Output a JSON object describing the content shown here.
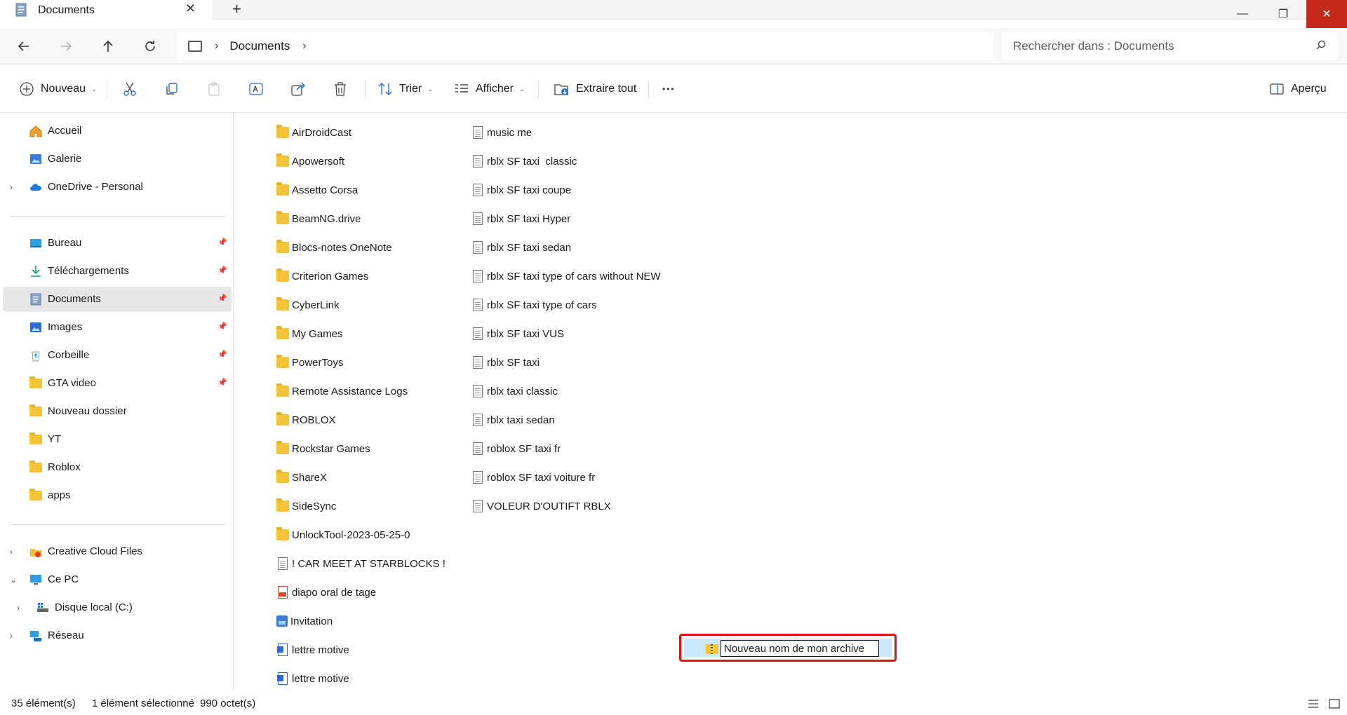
{
  "window": {
    "tab_title": "Documents",
    "tab_close_glyph": "✕",
    "new_tab_glyph": "+",
    "minimize_glyph": "—",
    "maximize_glyph": "❐",
    "close_glyph": "✕"
  },
  "addressbar": {
    "crumb": "Documents",
    "search_placeholder": "Rechercher dans : Documents"
  },
  "toolbar": {
    "new_label": "Nouveau",
    "sort_label": "Trier",
    "view_label": "Afficher",
    "extract_label": "Extraire tout",
    "more_glyph": "•••",
    "preview_label": "Aperçu"
  },
  "sidebar": {
    "quick": [
      {
        "label": "Accueil",
        "icon": "home-icon"
      },
      {
        "label": "Galerie",
        "icon": "gallery-icon"
      },
      {
        "label": "OneDrive - Personal",
        "icon": "cloud-icon"
      }
    ],
    "pinned": [
      {
        "label": "Bureau",
        "icon": "desktop-icon"
      },
      {
        "label": "Téléchargements",
        "icon": "download-icon"
      },
      {
        "label": "Documents",
        "icon": "documents-icon"
      },
      {
        "label": "Images",
        "icon": "images-icon"
      },
      {
        "label": "Corbeille",
        "icon": "recycle-bin-icon"
      },
      {
        "label": "GTA video",
        "icon": "folder-icon"
      },
      {
        "label": "Nouveau dossier",
        "icon": "folder-icon"
      },
      {
        "label": "YT",
        "icon": "folder-icon"
      },
      {
        "label": "Roblox",
        "icon": "folder-icon"
      },
      {
        "label": "apps",
        "icon": "folder-icon"
      }
    ],
    "tree": [
      {
        "label": "Creative Cloud Files",
        "icon": "creative-cloud-icon"
      },
      {
        "label": "Ce PC",
        "icon": "computer-icon"
      },
      {
        "label": "Disque local (C:)",
        "icon": "drive-icon"
      },
      {
        "label": "Réseau",
        "icon": "network-icon"
      }
    ]
  },
  "files": {
    "col1": [
      {
        "name": "AirDroidCast",
        "type": "folder"
      },
      {
        "name": "Apowersoft",
        "type": "folder"
      },
      {
        "name": "Assetto Corsa",
        "type": "folder"
      },
      {
        "name": "BeamNG.drive",
        "type": "folder"
      },
      {
        "name": "Blocs-notes OneNote",
        "type": "folder"
      },
      {
        "name": "Criterion Games",
        "type": "folder"
      },
      {
        "name": "CyberLink",
        "type": "folder"
      },
      {
        "name": "My Games",
        "type": "folder"
      },
      {
        "name": "PowerToys",
        "type": "folder"
      },
      {
        "name": "Remote Assistance Logs",
        "type": "folder"
      },
      {
        "name": "ROBLOX",
        "type": "folder"
      },
      {
        "name": "Rockstar Games",
        "type": "folder"
      },
      {
        "name": "ShareX",
        "type": "folder"
      },
      {
        "name": "SideSync",
        "type": "folder"
      },
      {
        "name": "UnlockTool-2023-05-25-0",
        "type": "folder"
      },
      {
        "name": "! CAR MEET AT STARBLOCKS !",
        "type": "text"
      },
      {
        "name": "diapo oral de tage",
        "type": "pdf"
      },
      {
        "name": "Invitation",
        "type": "image"
      },
      {
        "name": "lettre motive",
        "type": "word"
      },
      {
        "name": "lettre motive",
        "type": "word"
      }
    ],
    "col2": [
      {
        "name": "music me",
        "type": "text"
      },
      {
        "name": "rblx SF taxi  classic",
        "type": "text"
      },
      {
        "name": "rblx SF taxi coupe",
        "type": "text"
      },
      {
        "name": "rblx SF taxi Hyper",
        "type": "text"
      },
      {
        "name": "rblx SF taxi sedan",
        "type": "text"
      },
      {
        "name": "rblx SF taxi type of cars without NEW",
        "type": "text"
      },
      {
        "name": "rblx SF taxi type of cars",
        "type": "text"
      },
      {
        "name": "rblx SF taxi VUS",
        "type": "text"
      },
      {
        "name": "rblx SF taxi",
        "type": "text"
      },
      {
        "name": "rblx taxi classic",
        "type": "text"
      },
      {
        "name": "rblx taxi sedan",
        "type": "text"
      },
      {
        "name": "roblox SF taxi fr",
        "type": "text"
      },
      {
        "name": "roblox SF taxi voiture fr",
        "type": "text"
      },
      {
        "name": "VOLEUR D'OUTIFT RBLX",
        "type": "text"
      }
    ],
    "renaming": {
      "value": "Nouveau nom de mon archive",
      "type": "zip"
    }
  },
  "status": {
    "count": "35 élément(s)",
    "selected": "1 élément sélectionné",
    "size": "990 octet(s)"
  },
  "colors": {
    "accent": "#0067c0",
    "selection": "#cce8ff",
    "highlight_border": "#e01010",
    "close_button": "#c42b1c",
    "folder": "#f3c437"
  }
}
